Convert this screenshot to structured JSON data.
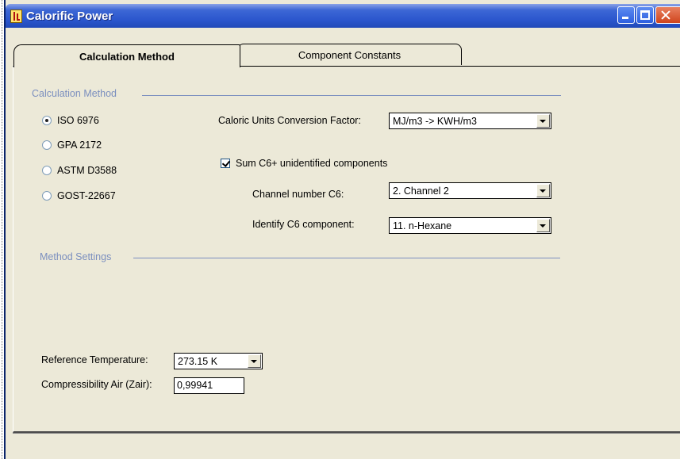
{
  "window": {
    "title": "Calorific Power"
  },
  "tabs": [
    {
      "label": "Calculation Method",
      "active": true
    },
    {
      "label": "Component Constants",
      "active": false
    }
  ],
  "calculation_method": {
    "group_title": "Calculation Method",
    "options": [
      {
        "label": "ISO 6976",
        "checked": true
      },
      {
        "label": "GPA 2172",
        "checked": false
      },
      {
        "label": "ASTM D3588",
        "checked": false
      },
      {
        "label": "GOST-22667",
        "checked": false
      }
    ],
    "caloric_units_label": "Caloric Units Conversion Factor:",
    "caloric_units_value": "MJ/m3 -> KWH/m3",
    "sum_c6_label": "Sum C6+ unidentified components",
    "sum_c6_checked": true,
    "channel_label": "Channel number C6:",
    "channel_value": "2. Channel 2",
    "identify_label": "Identify C6 component:",
    "identify_value": "11. n-Hexane"
  },
  "method_settings": {
    "group_title": "Method Settings",
    "ref_temp_label": "Reference Temperature:",
    "ref_temp_value": "273.15 K",
    "zair_label": "Compressibility Air (Zair):",
    "zair_value": "0,99941"
  },
  "colors": {
    "titlebar": "#2a55cc",
    "background": "#ece9d8",
    "group_title": "#7b8fbf"
  }
}
